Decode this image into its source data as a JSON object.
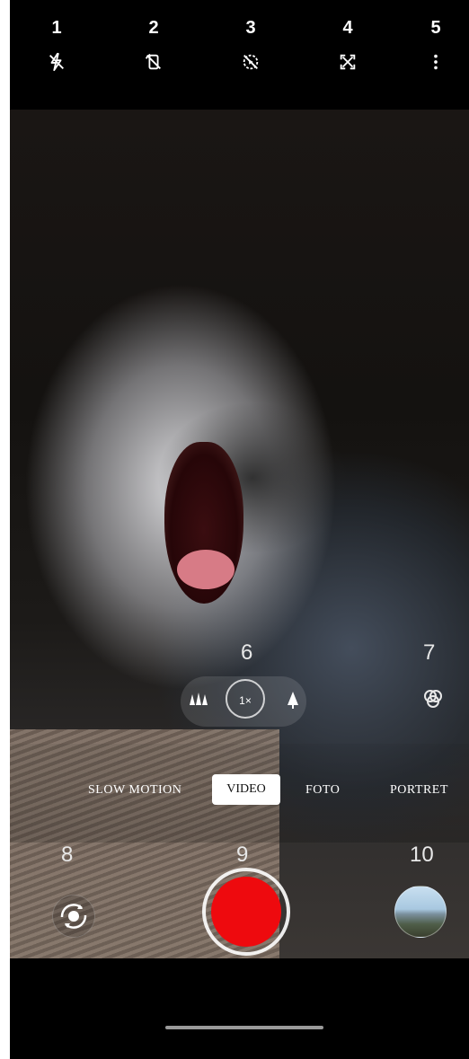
{
  "top_bar": {
    "items": [
      {
        "number": "1",
        "icon": "flash-off-icon"
      },
      {
        "number": "2",
        "icon": "rotate-off-icon"
      },
      {
        "number": "3",
        "icon": "motion-photo-off-icon"
      },
      {
        "number": "4",
        "icon": "aspect-ratio-icon"
      },
      {
        "number": "5",
        "icon": "more-options-icon"
      }
    ]
  },
  "zoom": {
    "number": "6",
    "wide_icon": "ultra-wide-trees-icon",
    "current_label": "1×",
    "tele_icon": "telephoto-tree-icon"
  },
  "filter": {
    "number": "7",
    "icon": "filter-icon"
  },
  "modes": {
    "items": [
      "SLOW MOTION",
      "VIDEO",
      "FOTO",
      "PORTRET"
    ],
    "selected": "VIDEO"
  },
  "flip_camera": {
    "number": "8",
    "icon": "switch-camera-icon"
  },
  "record": {
    "number": "9",
    "color": "#ee0a0e"
  },
  "gallery": {
    "number": "10",
    "icon": "gallery-thumbnail"
  }
}
